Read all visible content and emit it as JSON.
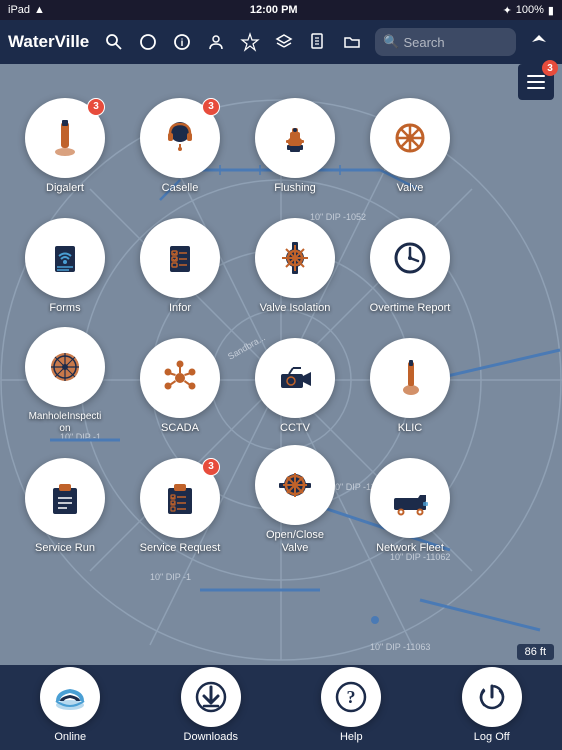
{
  "statusBar": {
    "left": "iPad",
    "time": "12:00 PM",
    "battery": "100%",
    "bluetooth": "BT"
  },
  "toolbar": {
    "title": "WaterVille",
    "searchPlaceholder": "Search",
    "icons": [
      "search",
      "circle",
      "info",
      "person",
      "star",
      "layers",
      "doc",
      "folder"
    ]
  },
  "hamburger": {
    "badge": "3"
  },
  "scaleBar": {
    "label": "86 ft"
  },
  "apps": [
    {
      "id": "digalert",
      "label": "Digalert",
      "badge": "3",
      "icon": "shovel"
    },
    {
      "id": "caselle",
      "label": "Caselle",
      "badge": "3",
      "icon": "headset"
    },
    {
      "id": "flushing",
      "label": "Flushing",
      "badge": null,
      "icon": "hydrant"
    },
    {
      "id": "valve",
      "label": "Valve",
      "badge": null,
      "icon": "valve"
    },
    {
      "id": "forms",
      "label": "Forms",
      "badge": null,
      "icon": "forms"
    },
    {
      "id": "infor",
      "label": "Infor",
      "badge": null,
      "icon": "infor"
    },
    {
      "id": "valve-isolation",
      "label": "Valve Isolation",
      "badge": null,
      "icon": "valve-iso"
    },
    {
      "id": "overtime-report",
      "label": "Overtime Report",
      "badge": null,
      "icon": "clock"
    },
    {
      "id": "manhole",
      "label": "ManholeInspection",
      "badge": null,
      "icon": "manhole"
    },
    {
      "id": "scada",
      "label": "SCADA",
      "badge": null,
      "icon": "scada"
    },
    {
      "id": "cctv",
      "label": "CCTV",
      "badge": null,
      "icon": "cctv"
    },
    {
      "id": "klic",
      "label": "KLIC",
      "badge": null,
      "icon": "shovel2"
    },
    {
      "id": "service-run",
      "label": "Service Run",
      "badge": null,
      "icon": "clipboard"
    },
    {
      "id": "service-request",
      "label": "Service Request",
      "badge": "3",
      "icon": "checklist"
    },
    {
      "id": "open-close-valve",
      "label": "Open/Close Valve",
      "badge": null,
      "icon": "valve2"
    },
    {
      "id": "network-fleet",
      "label": "Network Fleet",
      "badge": null,
      "icon": "truck"
    }
  ],
  "bottomBar": [
    {
      "id": "online",
      "label": "Online",
      "icon": "cloud"
    },
    {
      "id": "downloads",
      "label": "Downloads",
      "icon": "download"
    },
    {
      "id": "help",
      "label": "Help",
      "icon": "question"
    },
    {
      "id": "log-off",
      "label": "Log Off",
      "icon": "logoff"
    }
  ],
  "colors": {
    "navy": "#1c2b4a",
    "orange": "#c0622a",
    "white": "#ffffff",
    "red": "#e74c3c",
    "mapBg": "#7a8a9e"
  }
}
